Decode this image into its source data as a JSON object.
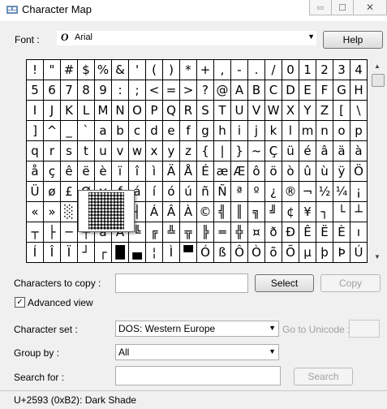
{
  "window": {
    "title": "Character Map",
    "minimize": "▭",
    "maximize": "☐",
    "close": "✕"
  },
  "font_row": {
    "label": "Font :",
    "icon": "O",
    "font_name": "Arial",
    "help": "Help"
  },
  "grid": [
    "!",
    "\"",
    "#",
    "$",
    "%",
    "&",
    "'",
    "(",
    ")",
    "*",
    "+",
    ",",
    "-",
    ".",
    "/",
    "0",
    "1",
    "2",
    "3",
    "4",
    "5",
    "6",
    "7",
    "8",
    "9",
    ":",
    ";",
    "<",
    "=",
    ">",
    "?",
    "@",
    "A",
    "B",
    "C",
    "D",
    "E",
    "F",
    "G",
    "H",
    "I",
    "J",
    "K",
    "L",
    "M",
    "N",
    "O",
    "P",
    "Q",
    "R",
    "S",
    "T",
    "U",
    "V",
    "W",
    "X",
    "Y",
    "Z",
    "[",
    "\\",
    "]",
    "^",
    "_",
    "`",
    "a",
    "b",
    "c",
    "d",
    "e",
    "f",
    "g",
    "h",
    "i",
    "j",
    "k",
    "l",
    "m",
    "n",
    "o",
    "p",
    "q",
    "r",
    "s",
    "t",
    "u",
    "v",
    "w",
    "x",
    "y",
    "z",
    "{",
    "|",
    "}",
    "~",
    "Ç",
    "ü",
    "é",
    "â",
    "ä",
    "à",
    "å",
    "ç",
    "ê",
    "ë",
    "è",
    "ï",
    "î",
    "ì",
    "Ä",
    "Å",
    "É",
    "æ",
    "Æ",
    "ô",
    "ö",
    "ò",
    "û",
    "ù",
    "ÿ",
    "Ö",
    "Ü",
    "ø",
    "£",
    "Ø",
    "×",
    "ƒ",
    "á",
    "í",
    "ó",
    "ú",
    "ñ",
    "Ñ",
    "ª",
    "º",
    "¿",
    "®",
    "¬",
    "½",
    "¼",
    "¡",
    "«",
    "»",
    "░",
    "▒",
    "▓",
    "│",
    "┤",
    "Á",
    "Â",
    "À",
    "©",
    "╣",
    "║",
    "╗",
    "╝",
    "¢",
    "¥",
    "┐",
    "└",
    "┴",
    "┬",
    "├",
    "─",
    "┼",
    "ã",
    "Ã",
    "╚",
    "╔",
    "╩",
    "╦",
    "╠",
    "═",
    "╬",
    "¤",
    "ð",
    "Ð",
    "Ê",
    "Ë",
    "È",
    "ı",
    "Í",
    "Î",
    "Ï",
    "┘",
    "┌",
    "█",
    "▄",
    "¦",
    "Ì",
    "▀",
    "Ó",
    "ß",
    "Ô",
    "Ò",
    "õ",
    "Õ",
    "µ",
    "þ",
    "Þ",
    "Ú"
  ],
  "copy_row": {
    "label": "Characters to copy :",
    "value": "",
    "select": "Select",
    "copy": "Copy"
  },
  "advanced": {
    "checked": true,
    "mark": "✓",
    "label": "Advanced view"
  },
  "charset": {
    "label": "Character set :",
    "value": "DOS: Western Europe",
    "goto_label": "Go to Unicode :",
    "goto_value": ""
  },
  "groupby": {
    "label": "Group by :",
    "value": "All"
  },
  "search": {
    "label": "Search for :",
    "value": "",
    "button": "Search"
  },
  "status": "U+2593 (0xB2): Dark Shade",
  "magnified_char": "▓"
}
